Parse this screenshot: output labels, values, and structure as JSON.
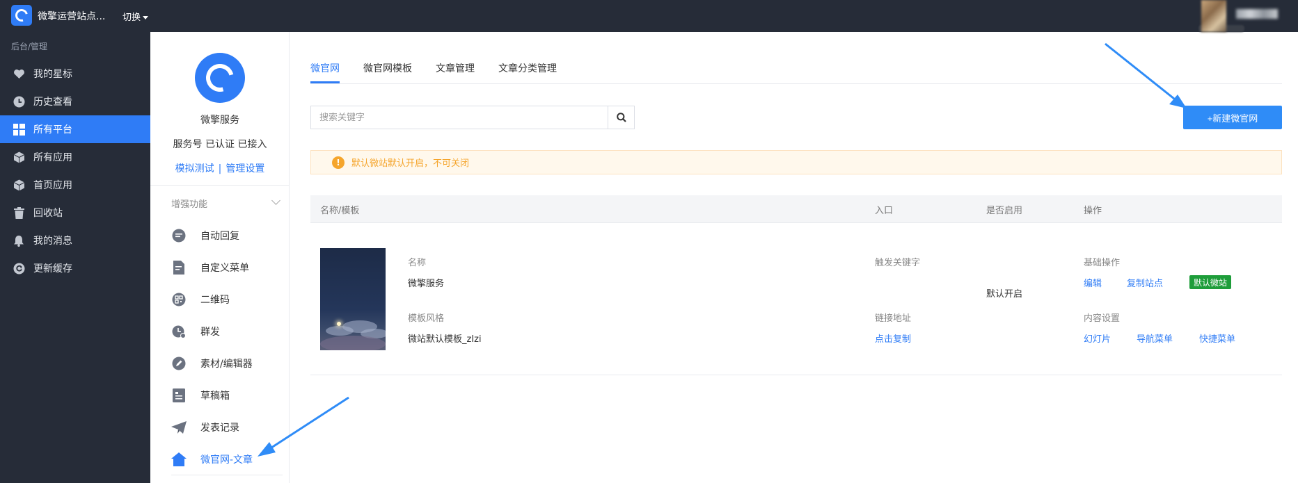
{
  "topbar": {
    "site_name": "微擎运营站点...",
    "switch_label": "切换"
  },
  "sidebar": {
    "section": "后台/管理",
    "items": [
      {
        "label": "我的星标",
        "icon": "heart-icon"
      },
      {
        "label": "历史查看",
        "icon": "clock-icon"
      },
      {
        "label": "所有平台",
        "icon": "grid-icon",
        "active": true
      },
      {
        "label": "所有应用",
        "icon": "cube-icon"
      },
      {
        "label": "首页应用",
        "icon": "cube-icon"
      },
      {
        "label": "回收站",
        "icon": "trash-icon"
      },
      {
        "label": "我的消息",
        "icon": "bell-icon"
      },
      {
        "label": "更新缓存",
        "icon": "refresh-icon"
      }
    ]
  },
  "account": {
    "name": "微擎服务",
    "status": "服务号 已认证 已接入",
    "link_test": "模拟测试",
    "link_sep": "|",
    "link_settings": "管理设置",
    "features_title": "增强功能",
    "features": [
      {
        "label": "自动回复",
        "icon": "chat-icon"
      },
      {
        "label": "自定义菜单",
        "icon": "document-edit-icon"
      },
      {
        "label": "二维码",
        "icon": "qrcode-icon"
      },
      {
        "label": "群发",
        "icon": "broadcast-icon"
      },
      {
        "label": "素材/编辑器",
        "icon": "pencil-icon"
      },
      {
        "label": "草稿箱",
        "icon": "drafts-icon"
      },
      {
        "label": "发表记录",
        "icon": "send-icon"
      },
      {
        "label": "微官网-文章",
        "icon": "home-icon",
        "active": true
      }
    ]
  },
  "main": {
    "tabs": [
      {
        "label": "微官网",
        "active": true
      },
      {
        "label": "微官网模板"
      },
      {
        "label": "文章管理"
      },
      {
        "label": "文章分类管理"
      }
    ],
    "search_placeholder": "搜索关键字",
    "new_button": "+新建微官网",
    "alert": "默认微站默认开启，不可关闭",
    "alert_icon": "!",
    "table": {
      "headers": [
        "名称/模板",
        "入口",
        "是否启用",
        "操作"
      ],
      "row": {
        "name_label": "名称",
        "name_value": "微擎服务",
        "template_label": "模板风格",
        "template_value": "微站默认模板_zIzi",
        "trigger_label": "触发关键字",
        "link_label": "链接地址",
        "link_value": "点击复制",
        "enabled_value": "默认开启",
        "basic_ops_label": "基础操作",
        "edit": "编辑",
        "copy_site": "复制站点",
        "default_badge": "默认微站",
        "content_label": "内容设置",
        "slides": "幻灯片",
        "nav_menu": "导航菜单",
        "quick_menu": "快捷菜单"
      }
    }
  },
  "colors": {
    "topbar": "#262c38",
    "accent": "#2f7cf6",
    "warning": "#f5a52c",
    "success_badge": "#1e9d3a"
  }
}
